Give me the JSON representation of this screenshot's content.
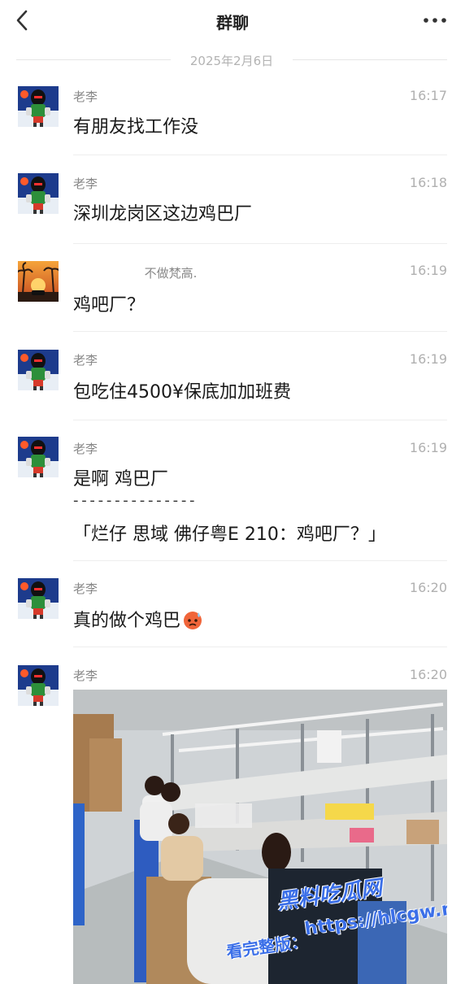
{
  "header": {
    "title": "群聊"
  },
  "date_separator": "2025年2月6日",
  "messages": [
    {
      "name": "老李",
      "time": "16:17",
      "text": "有朋友找工作没"
    },
    {
      "name": "老李",
      "time": "16:18",
      "text": "深圳龙岗区这边鸡巴厂"
    },
    {
      "name": "不做梵高.",
      "time": "16:19",
      "text": "鸡吧厂？"
    },
    {
      "name": "老李",
      "time": "16:19",
      "text": "包吃住4500¥保底加加班费"
    },
    {
      "name": "老李",
      "time": "16:19",
      "text": "是啊 鸡巴厂",
      "separator": "- - - - - - - - - - - - - - -",
      "quote": "「烂仔 思域 佛仔粤E 210：鸡吧厂？」"
    },
    {
      "name": "老李",
      "time": "16:20",
      "text": "真的做个鸡巴"
    },
    {
      "name": "老李",
      "time": "16:20"
    }
  ],
  "icons": {
    "back": "chevron-left-icon",
    "more": "more-dots-icon",
    "emoji": "sweat-face-emoji"
  },
  "watermark": {
    "line1": "黑料吃瓜网",
    "line2": "https://hlcgw.net",
    "line3": "看完整版："
  }
}
